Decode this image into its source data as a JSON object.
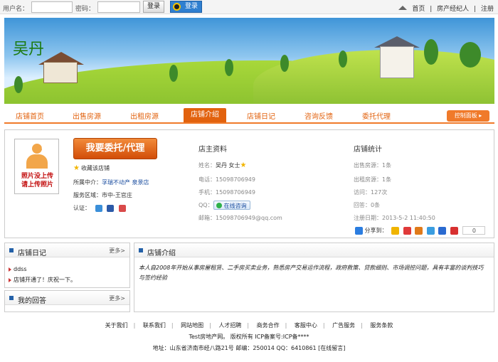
{
  "topbar": {
    "username_label": "用户名：",
    "password_label": "密码：",
    "login_button": "登录",
    "qq_login_button": "登录",
    "links": [
      "首页",
      "房产经纪人",
      "注册"
    ],
    "sep": "|"
  },
  "banner": {
    "shop_name": "吴丹"
  },
  "nav": {
    "items": [
      "店铺首页",
      "出售房源",
      "出租房源",
      "店铺介绍",
      "店铺日记",
      "咨询反馈",
      "委托代理"
    ],
    "control_panel": "控制面板",
    "accent": "#e2620e"
  },
  "profile": {
    "photo_text": "照片没上传\n请上传照片",
    "commission_button": "我要委托/代理",
    "favorite": "收藏该店铺",
    "agency_label": "所属中介：",
    "agency_value": "孚瑞不动产 泉景店",
    "area_label": "服务区域：",
    "area_value": "市中-王官庄",
    "cert_label": "认证："
  },
  "owner": {
    "title": "店主资料",
    "name_label": "姓名：",
    "name_value": "吴丹 女士",
    "phone_label": "电话：",
    "phone_value": "15098706949",
    "mobile_label": "手机：",
    "mobile_value": "15098706949",
    "qq_label": "QQ：",
    "qq_button": "在线咨询",
    "email_label": "邮箱：",
    "email_value": "15098706949@qq.com"
  },
  "stats": {
    "title": "店铺统计",
    "sale_label": "出售房源：",
    "sale_value": "1条",
    "rent_label": "出租房源：",
    "rent_value": "1条",
    "visits_label": "访问：",
    "visits_value": "127次",
    "answers_label": "回答：",
    "answers_value": "0条",
    "reg_label": "注册日期：",
    "reg_value": "2013-5-2 11:40:50",
    "share_label": "分享到：",
    "share_count": "0"
  },
  "diary": {
    "title": "店铺日记",
    "more": "更多>",
    "items": [
      "ddss",
      "店铺开通了！庆祝一下。"
    ]
  },
  "answers": {
    "title": "我的回答",
    "more": "更多>"
  },
  "intro": {
    "title": "店铺介绍",
    "text": "本人自2008年开始从事房屋租赁、二手房买卖业务，熟悉房产交易运作流程，政府救策、贷款细则、市场调控问题，具有丰富的谈判技巧与签约经验"
  },
  "footer": {
    "links": [
      "关于我们",
      "联系我们",
      "网站地图",
      "人才招聘",
      "商务合作",
      "客服中心",
      "广告服务",
      "服务条款"
    ],
    "copyright": "Test房地产网。 版权所有 ICP备案号:ICP备****",
    "address": "地址：山东省济南市经八路21号 邮编：250014 QQ：6410861 [在线留言]"
  }
}
